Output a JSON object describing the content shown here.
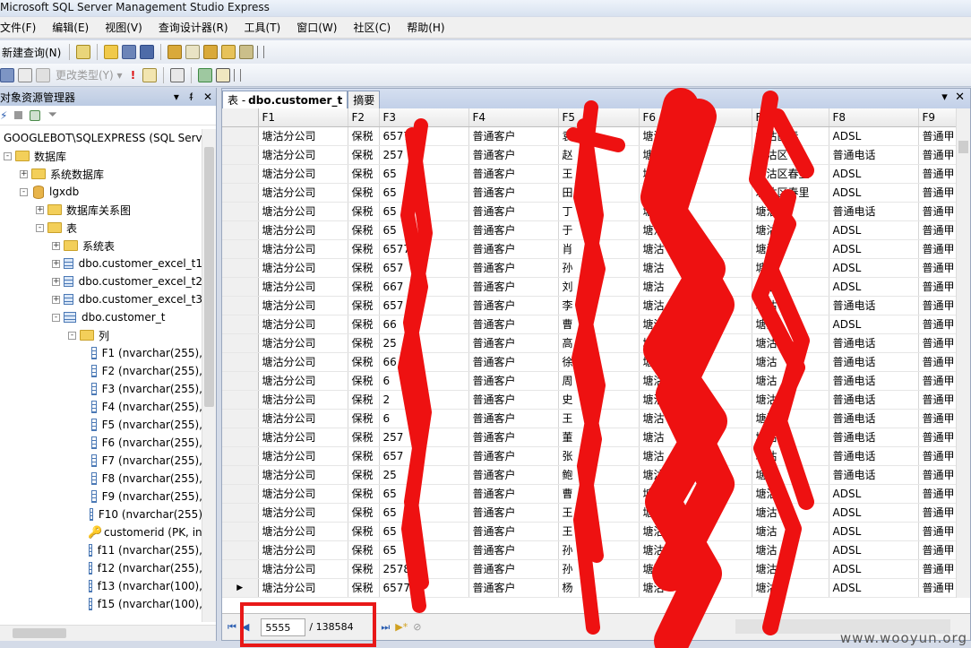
{
  "window": {
    "title": "Microsoft SQL Server Management Studio Express"
  },
  "menu": [
    "文件(F)",
    "编辑(E)",
    "视图(V)",
    "查询设计器(R)",
    "工具(T)",
    "窗口(W)",
    "社区(C)",
    "帮助(H)"
  ],
  "toolbar": {
    "new_query": "新建查询(N)",
    "change_type": "更改类型(Y)"
  },
  "object_explorer": {
    "title": "对象资源管理器",
    "nodes": [
      {
        "label": "GOOGLEBOT\\SQLEXPRESS (SQL Server",
        "icon": "server-icon",
        "level": 0,
        "exp": "-"
      },
      {
        "label": "数据库",
        "icon": "folder-icon",
        "level": 0,
        "exp": "-"
      },
      {
        "label": "系统数据库",
        "icon": "folder-icon",
        "level": 1,
        "exp": "+"
      },
      {
        "label": "lgxdb",
        "icon": "database-icon",
        "level": 1,
        "exp": "-"
      },
      {
        "label": "数据库关系图",
        "icon": "folder-icon",
        "level": 2,
        "exp": "+"
      },
      {
        "label": "表",
        "icon": "folder-icon",
        "level": 2,
        "exp": "-"
      },
      {
        "label": "系统表",
        "icon": "folder-icon",
        "level": 3,
        "exp": "+"
      },
      {
        "label": "dbo.customer_excel_t1",
        "icon": "table-icon",
        "level": 3,
        "exp": "+"
      },
      {
        "label": "dbo.customer_excel_t2",
        "icon": "table-icon",
        "level": 3,
        "exp": "+"
      },
      {
        "label": "dbo.customer_excel_t3",
        "icon": "table-icon",
        "level": 3,
        "exp": "+"
      },
      {
        "label": "dbo.customer_t",
        "icon": "table-icon",
        "level": 3,
        "exp": "-"
      },
      {
        "label": "列",
        "icon": "folder-icon",
        "level": 4,
        "exp": "-"
      },
      {
        "label": "F1 (nvarchar(255),",
        "icon": "column-icon",
        "level": 5,
        "exp": ""
      },
      {
        "label": "F2 (nvarchar(255),",
        "icon": "column-icon",
        "level": 5,
        "exp": ""
      },
      {
        "label": "F3 (nvarchar(255),",
        "icon": "column-icon",
        "level": 5,
        "exp": ""
      },
      {
        "label": "F4 (nvarchar(255),",
        "icon": "column-icon",
        "level": 5,
        "exp": ""
      },
      {
        "label": "F5 (nvarchar(255),",
        "icon": "column-icon",
        "level": 5,
        "exp": ""
      },
      {
        "label": "F6 (nvarchar(255),",
        "icon": "column-icon",
        "level": 5,
        "exp": ""
      },
      {
        "label": "F7 (nvarchar(255),",
        "icon": "column-icon",
        "level": 5,
        "exp": ""
      },
      {
        "label": "F8 (nvarchar(255),",
        "icon": "column-icon",
        "level": 5,
        "exp": ""
      },
      {
        "label": "F9 (nvarchar(255),",
        "icon": "column-icon",
        "level": 5,
        "exp": ""
      },
      {
        "label": "F10 (nvarchar(255)",
        "icon": "column-icon",
        "level": 5,
        "exp": ""
      },
      {
        "label": "customerid (PK, int",
        "icon": "key-icon",
        "level": 5,
        "exp": ""
      },
      {
        "label": "f11 (nvarchar(255),",
        "icon": "column-icon",
        "level": 5,
        "exp": ""
      },
      {
        "label": "f12 (nvarchar(255),",
        "icon": "column-icon",
        "level": 5,
        "exp": ""
      },
      {
        "label": "f13 (nvarchar(100),",
        "icon": "column-icon",
        "level": 5,
        "exp": ""
      },
      {
        "label": "f15 (nvarchar(100),",
        "icon": "column-icon",
        "level": 5,
        "exp": ""
      }
    ]
  },
  "document": {
    "tab_prefix": "表 -",
    "tab_title": "dbo.customer_t",
    "tab_summary": "摘要",
    "columns": [
      "F1",
      "F2",
      "F3",
      "F4",
      "F5",
      "F6",
      "F7",
      "F8",
      "F9"
    ],
    "rows": [
      [
        "塘沽分公司",
        "保税",
        "6577",
        "普通客户",
        "袁",
        "塘沽区",
        "塘沽区春",
        "ADSL",
        "普通甲"
      ],
      [
        "塘沽分公司",
        "保税",
        "257",
        "普通客户",
        "赵",
        "塘沽区",
        "塘沽区",
        "普通电话",
        "普通甲"
      ],
      [
        "塘沽分公司",
        "保税",
        "65",
        "普通客户",
        "王",
        "塘沽",
        "塘沽区春里",
        "ADSL",
        "普通甲"
      ],
      [
        "塘沽分公司",
        "保税",
        "65",
        "普通客户",
        "田",
        "塘沽",
        "塘沽区春里",
        "ADSL",
        "普通甲"
      ],
      [
        "塘沽分公司",
        "保税",
        "65",
        "普通客户",
        "丁",
        "塘沽",
        "塘沽区",
        "普通电话",
        "普通甲"
      ],
      [
        "塘沽分公司",
        "保税",
        "65",
        "普通客户",
        "于",
        "塘沽",
        "塘沽区",
        "ADSL",
        "普通甲"
      ],
      [
        "塘沽分公司",
        "保税",
        "6577",
        "普通客户",
        "肖",
        "塘沽",
        "塘沽",
        "ADSL",
        "普通甲"
      ],
      [
        "塘沽分公司",
        "保税",
        "657",
        "普通客户",
        "孙",
        "塘沽",
        "塘沽",
        "ADSL",
        "普通甲"
      ],
      [
        "塘沽分公司",
        "保税",
        "667",
        "普通客户",
        "刘",
        "塘沽",
        "塘沽",
        "ADSL",
        "普通甲"
      ],
      [
        "塘沽分公司",
        "保税",
        "657",
        "普通客户",
        "李",
        "塘沽",
        "塘沽",
        "普通电话",
        "普通甲"
      ],
      [
        "塘沽分公司",
        "保税",
        "66",
        "普通客户",
        "曹",
        "塘沽",
        "塘沽",
        "ADSL",
        "普通甲"
      ],
      [
        "塘沽分公司",
        "保税",
        "25",
        "普通客户",
        "高",
        "塘沽",
        "塘沽",
        "普通电话",
        "普通甲"
      ],
      [
        "塘沽分公司",
        "保税",
        "66",
        "普通客户",
        "徐",
        "塘沽",
        "塘沽",
        "普通电话",
        "普通甲"
      ],
      [
        "塘沽分公司",
        "保税",
        "6",
        "普通客户",
        "周",
        "塘沽",
        "塘沽",
        "普通电话",
        "普通甲"
      ],
      [
        "塘沽分公司",
        "保税",
        "2",
        "普通客户",
        "史",
        "塘沽",
        "塘沽",
        "普通电话",
        "普通甲"
      ],
      [
        "塘沽分公司",
        "保税",
        "6",
        "普通客户",
        "王",
        "塘沽",
        "塘沽",
        "普通电话",
        "普通甲"
      ],
      [
        "塘沽分公司",
        "保税",
        "257",
        "普通客户",
        "董",
        "塘沽",
        "塘沽",
        "普通电话",
        "普通甲"
      ],
      [
        "塘沽分公司",
        "保税",
        "657",
        "普通客户",
        "张",
        "塘沽",
        "塘沽",
        "普通电话",
        "普通甲"
      ],
      [
        "塘沽分公司",
        "保税",
        "25",
        "普通客户",
        "鲍",
        "塘沽",
        "塘沽",
        "普通电话",
        "普通甲"
      ],
      [
        "塘沽分公司",
        "保税",
        "65",
        "普通客户",
        "曹",
        "塘沽",
        "塘沽",
        "ADSL",
        "普通甲"
      ],
      [
        "塘沽分公司",
        "保税",
        "65",
        "普通客户",
        "王",
        "塘沽",
        "塘沽",
        "ADSL",
        "普通甲"
      ],
      [
        "塘沽分公司",
        "保税",
        "65",
        "普通客户",
        "王",
        "塘沽",
        "塘沽",
        "ADSL",
        "普通甲"
      ],
      [
        "塘沽分公司",
        "保税",
        "65",
        "普通客户",
        "孙",
        "塘沽",
        "塘沽",
        "ADSL",
        "普通甲"
      ],
      [
        "塘沽分公司",
        "保税",
        "2578",
        "普通客户",
        "孙",
        "塘沽",
        "塘沽",
        "ADSL",
        "普通甲"
      ],
      [
        "塘沽分公司",
        "保税",
        "6577",
        "普通客户",
        "杨",
        "塘沽",
        "塘沽",
        "ADSL",
        "普通甲"
      ]
    ]
  },
  "navigator": {
    "current": "5555",
    "total": "/ 138584"
  },
  "watermark": "www.wooyun.org",
  "colors": {
    "redaction": "#ee1111",
    "accent": "#2a5db0"
  }
}
